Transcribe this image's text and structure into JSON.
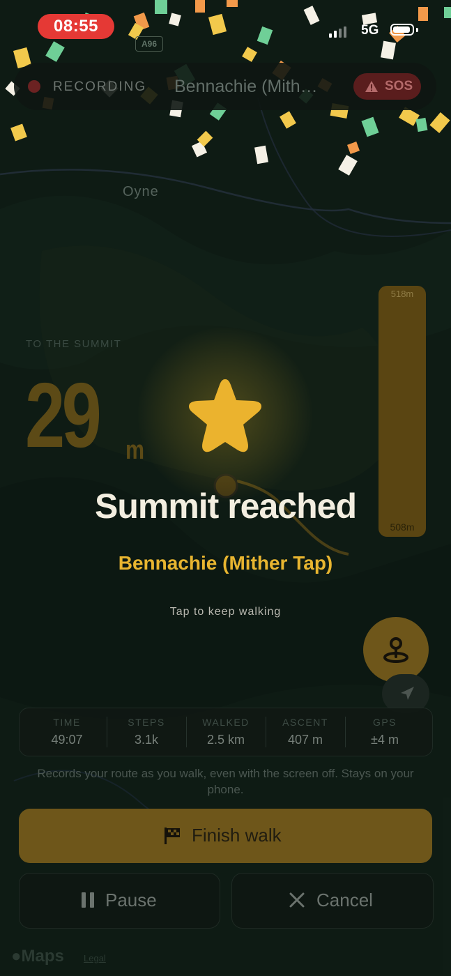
{
  "status_bar": {
    "time": "08:55",
    "network": "5G"
  },
  "map": {
    "road_label": "A96",
    "place_label": "Oyne",
    "attribution": "Maps",
    "legal": "Legal"
  },
  "topbar": {
    "recording_label": "RECORDING",
    "peak_name": "Bennachie (Mith…",
    "sos_label": "SOS"
  },
  "gauge": {
    "top_label": "518m",
    "bottom_label": "508m"
  },
  "summit_distance": {
    "caption": "TO THE SUMMIT",
    "value": "29",
    "unit": "m"
  },
  "celebration": {
    "title": "Summit reached",
    "peak": "Bennachie (Mither Tap)",
    "hint": "Tap to keep walking"
  },
  "stats": [
    {
      "label": "TIME",
      "value": "49:07"
    },
    {
      "label": "STEPS",
      "value": "3.1k"
    },
    {
      "label": "WALKED",
      "value": "2.5 km"
    },
    {
      "label": "ASCENT",
      "value": "407 m"
    },
    {
      "label": "GPS",
      "value": "±4 m"
    }
  ],
  "note": "Records your route as you walk, even with the screen off. Stays on your phone.",
  "actions": {
    "finish": "Finish walk",
    "pause": "Pause",
    "cancel": "Cancel"
  },
  "colors": {
    "accent": "#e8b530",
    "recording_red": "#e53935",
    "confetti": [
      "#f2c94c",
      "#6fcf97",
      "#f5f1e6",
      "#f2994a"
    ]
  },
  "icons": [
    "star-icon",
    "location-pin-icon",
    "navigation-arrow-icon",
    "warning-icon",
    "checkered-flag-icon",
    "pause-icon",
    "close-icon"
  ]
}
